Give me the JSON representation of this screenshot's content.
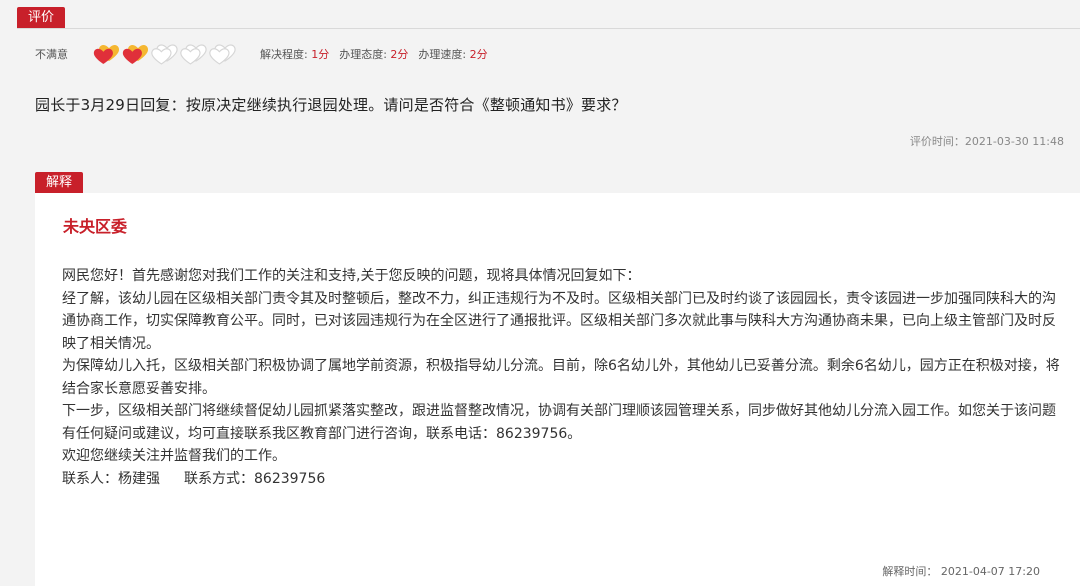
{
  "evaluation": {
    "tag": "评价",
    "rating_label": "不满意",
    "hearts": {
      "filled": 2,
      "total": 5
    },
    "metrics": [
      {
        "label": "解决程度:",
        "value": "1分"
      },
      {
        "label": "办理态度:",
        "value": "2分"
      },
      {
        "label": "办理速度:",
        "value": "2分"
      }
    ],
    "question": "园长于3月29日回复：按原决定继续执行退园处理。请问是否符合《整顿通知书》要求？",
    "time": "评价时间：2021-03-30 11:48"
  },
  "explanation": {
    "tag": "解释",
    "org": "未央区委",
    "paragraphs": [
      "网民您好！首先感谢您对我们工作的关注和支持,关于您反映的问题，现将具体情况回复如下：",
      "经了解，该幼儿园在区级相关部门责令其及时整顿后，整改不力，纠正违规行为不及时。区级相关部门已及时约谈了该园园长，责令该园进一步加强同陕科大的沟通协商工作，切实保障教育公平。同时，已对该园违规行为在全区进行了通报批评。区级相关部门多次就此事与陕科大方沟通协商未果，已向上级主管部门及时反映了相关情况。",
      "为保障幼儿入托，区级相关部门积极协调了属地学前资源，积极指导幼儿分流。目前，除6名幼儿外，其他幼儿已妥善分流。剩余6名幼儿，园方正在积极对接，将结合家长意愿妥善安排。",
      "下一步，区级相关部门将继续督促幼儿园抓紧落实整改，跟进监督整改情况，协调有关部门理顺该园管理关系，同步做好其他幼儿分流入园工作。如您关于该问题有任何疑问或建议，均可直接联系我区教育部门进行咨询，联系电话：86239756。",
      "欢迎您继续关注并监督我们的工作。"
    ],
    "contact_person": "联系人：杨建强",
    "contact_method": "联系方式：86239756",
    "time": "解释时间：  2021-04-07 17:20"
  },
  "colors": {
    "accent": "#c8202a",
    "heart_gold": "#f5b731",
    "heart_red": "#e0303a"
  }
}
